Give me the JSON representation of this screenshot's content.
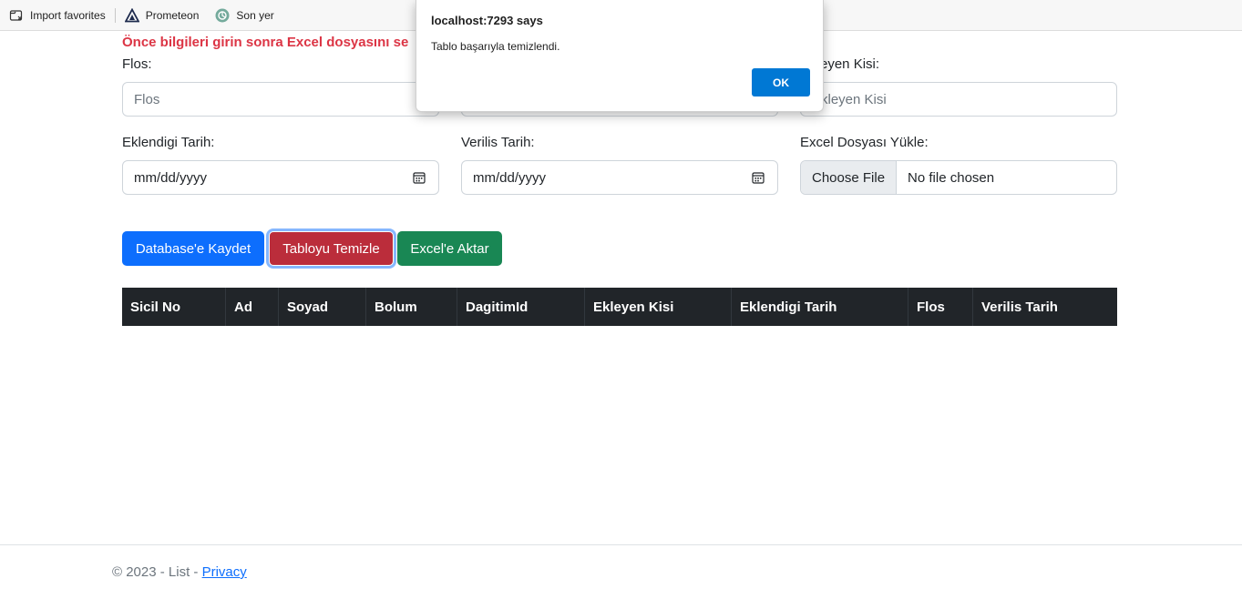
{
  "favorites_bar": {
    "items": [
      {
        "label": "Import favorites",
        "icon": "import-favorites-icon"
      },
      {
        "label": "Prometeon",
        "icon": "prometeon-logo-icon"
      },
      {
        "label": "Son yer",
        "icon": "chatgpt-icon"
      }
    ]
  },
  "form": {
    "warning": "Önce bilgileri girin sonra Excel dosyasını se",
    "flos": {
      "label": "Flos:",
      "placeholder": "Flos"
    },
    "ekleyen_kisi": {
      "label": "eyen Kisi:",
      "placeholder": "kleyen Kisi"
    },
    "eklendigi_tarih": {
      "label": "Eklendigi Tarih:",
      "value": "mm/dd/yyyy"
    },
    "verilis_tarih": {
      "label": "Verilis Tarih:",
      "value": "mm/dd/yyyy"
    },
    "excel_upload": {
      "label": "Excel Dosyası Yükle:",
      "button": "Choose File",
      "status": "No file chosen"
    }
  },
  "buttons": {
    "save": "Database'e Kaydet",
    "clear": "Tabloyu Temizle",
    "export": "Excel'e Aktar"
  },
  "table": {
    "headers": [
      "Sicil No",
      "Ad",
      "Soyad",
      "Bolum",
      "DagitimId",
      "Ekleyen Kisi",
      "Eklendigi Tarih",
      "Flos",
      "Verilis Tarih"
    ]
  },
  "footer": {
    "text": "© 2023 - List - ",
    "link": "Privacy"
  },
  "dialog": {
    "title": "localhost:7293 says",
    "message": "Tablo başarıyla temizlendi.",
    "ok": "OK"
  },
  "colors": {
    "primary": "#0d6efd",
    "danger": "#bb2d3b",
    "success": "#198754",
    "table_header": "#212529",
    "warning_text": "#dc3545",
    "dialog_ok": "#0078d4"
  }
}
